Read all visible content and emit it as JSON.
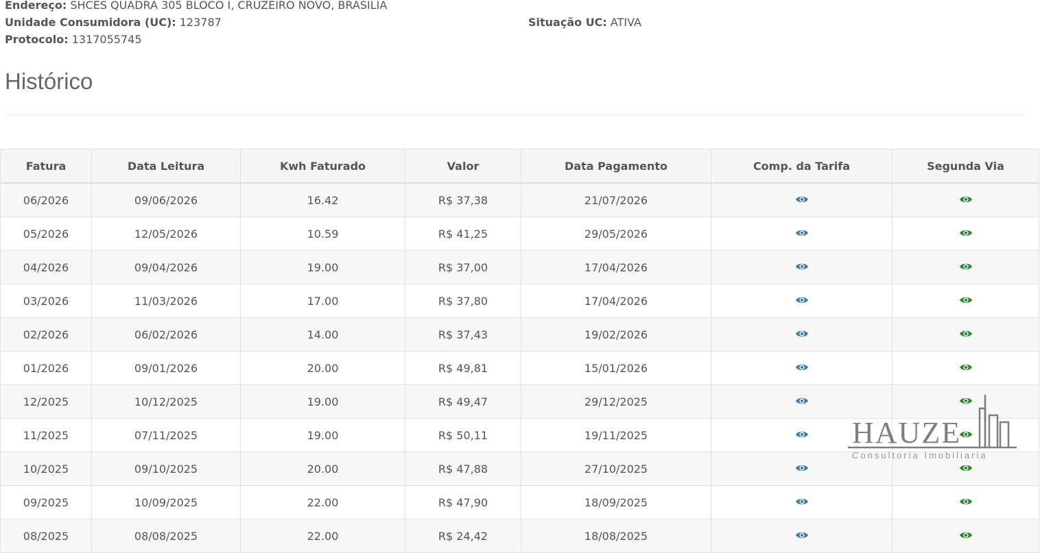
{
  "info": {
    "endereco_label": "Endereço:",
    "endereco_value": "SHCES QUADRA 305 BLOCO I, CRUZEIRO NOVO, BRASILIA",
    "uc_label": "Unidade Consumidora (UC):",
    "uc_value": "123787",
    "situacao_label": "Situação UC:",
    "situacao_value": "ATIVA",
    "protocolo_label": "Protocolo:",
    "protocolo_value": "1317055745"
  },
  "historico": {
    "title": "Histórico",
    "columns": [
      "Fatura",
      "Data Leitura",
      "Kwh Faturado",
      "Valor",
      "Data Pagamento",
      "Comp. da Tarifa",
      "Segunda Via"
    ],
    "rows": [
      {
        "fatura": "06/2026",
        "data_leitura": "09/06/2026",
        "kwh": "16.42",
        "valor": "R$ 37,38",
        "data_pagamento": "21/07/2026"
      },
      {
        "fatura": "05/2026",
        "data_leitura": "12/05/2026",
        "kwh": "10.59",
        "valor": "R$ 41,25",
        "data_pagamento": "29/05/2026"
      },
      {
        "fatura": "04/2026",
        "data_leitura": "09/04/2026",
        "kwh": "19.00",
        "valor": "R$ 37,00",
        "data_pagamento": "17/04/2026"
      },
      {
        "fatura": "03/2026",
        "data_leitura": "11/03/2026",
        "kwh": "17.00",
        "valor": "R$ 37,80",
        "data_pagamento": "17/04/2026"
      },
      {
        "fatura": "02/2026",
        "data_leitura": "06/02/2026",
        "kwh": "14.00",
        "valor": "R$ 37,43",
        "data_pagamento": "19/02/2026"
      },
      {
        "fatura": "01/2026",
        "data_leitura": "09/01/2026",
        "kwh": "20.00",
        "valor": "R$ 49,81",
        "data_pagamento": "15/01/2026"
      },
      {
        "fatura": "12/2025",
        "data_leitura": "10/12/2025",
        "kwh": "19.00",
        "valor": "R$ 49,47",
        "data_pagamento": "29/12/2025"
      },
      {
        "fatura": "11/2025",
        "data_leitura": "07/11/2025",
        "kwh": "19.00",
        "valor": "R$ 50,11",
        "data_pagamento": "19/11/2025"
      },
      {
        "fatura": "10/2025",
        "data_leitura": "09/10/2025",
        "kwh": "20.00",
        "valor": "R$ 47,88",
        "data_pagamento": "27/10/2025"
      },
      {
        "fatura": "09/2025",
        "data_leitura": "10/09/2025",
        "kwh": "22.00",
        "valor": "R$ 47,90",
        "data_pagamento": "18/09/2025"
      },
      {
        "fatura": "08/2025",
        "data_leitura": "08/08/2025",
        "kwh": "22.00",
        "valor": "R$ 24,42",
        "data_pagamento": "18/08/2025"
      }
    ]
  },
  "icons": {
    "comp_tarifa": "eye-icon",
    "segunda_via": "eye-icon",
    "comp_tarifa_color": "#3a7ab8",
    "segunda_via_color": "#2a8a2a"
  },
  "watermark": {
    "name": "HAUZE",
    "tagline": "Consultoria Imobiliaria"
  }
}
